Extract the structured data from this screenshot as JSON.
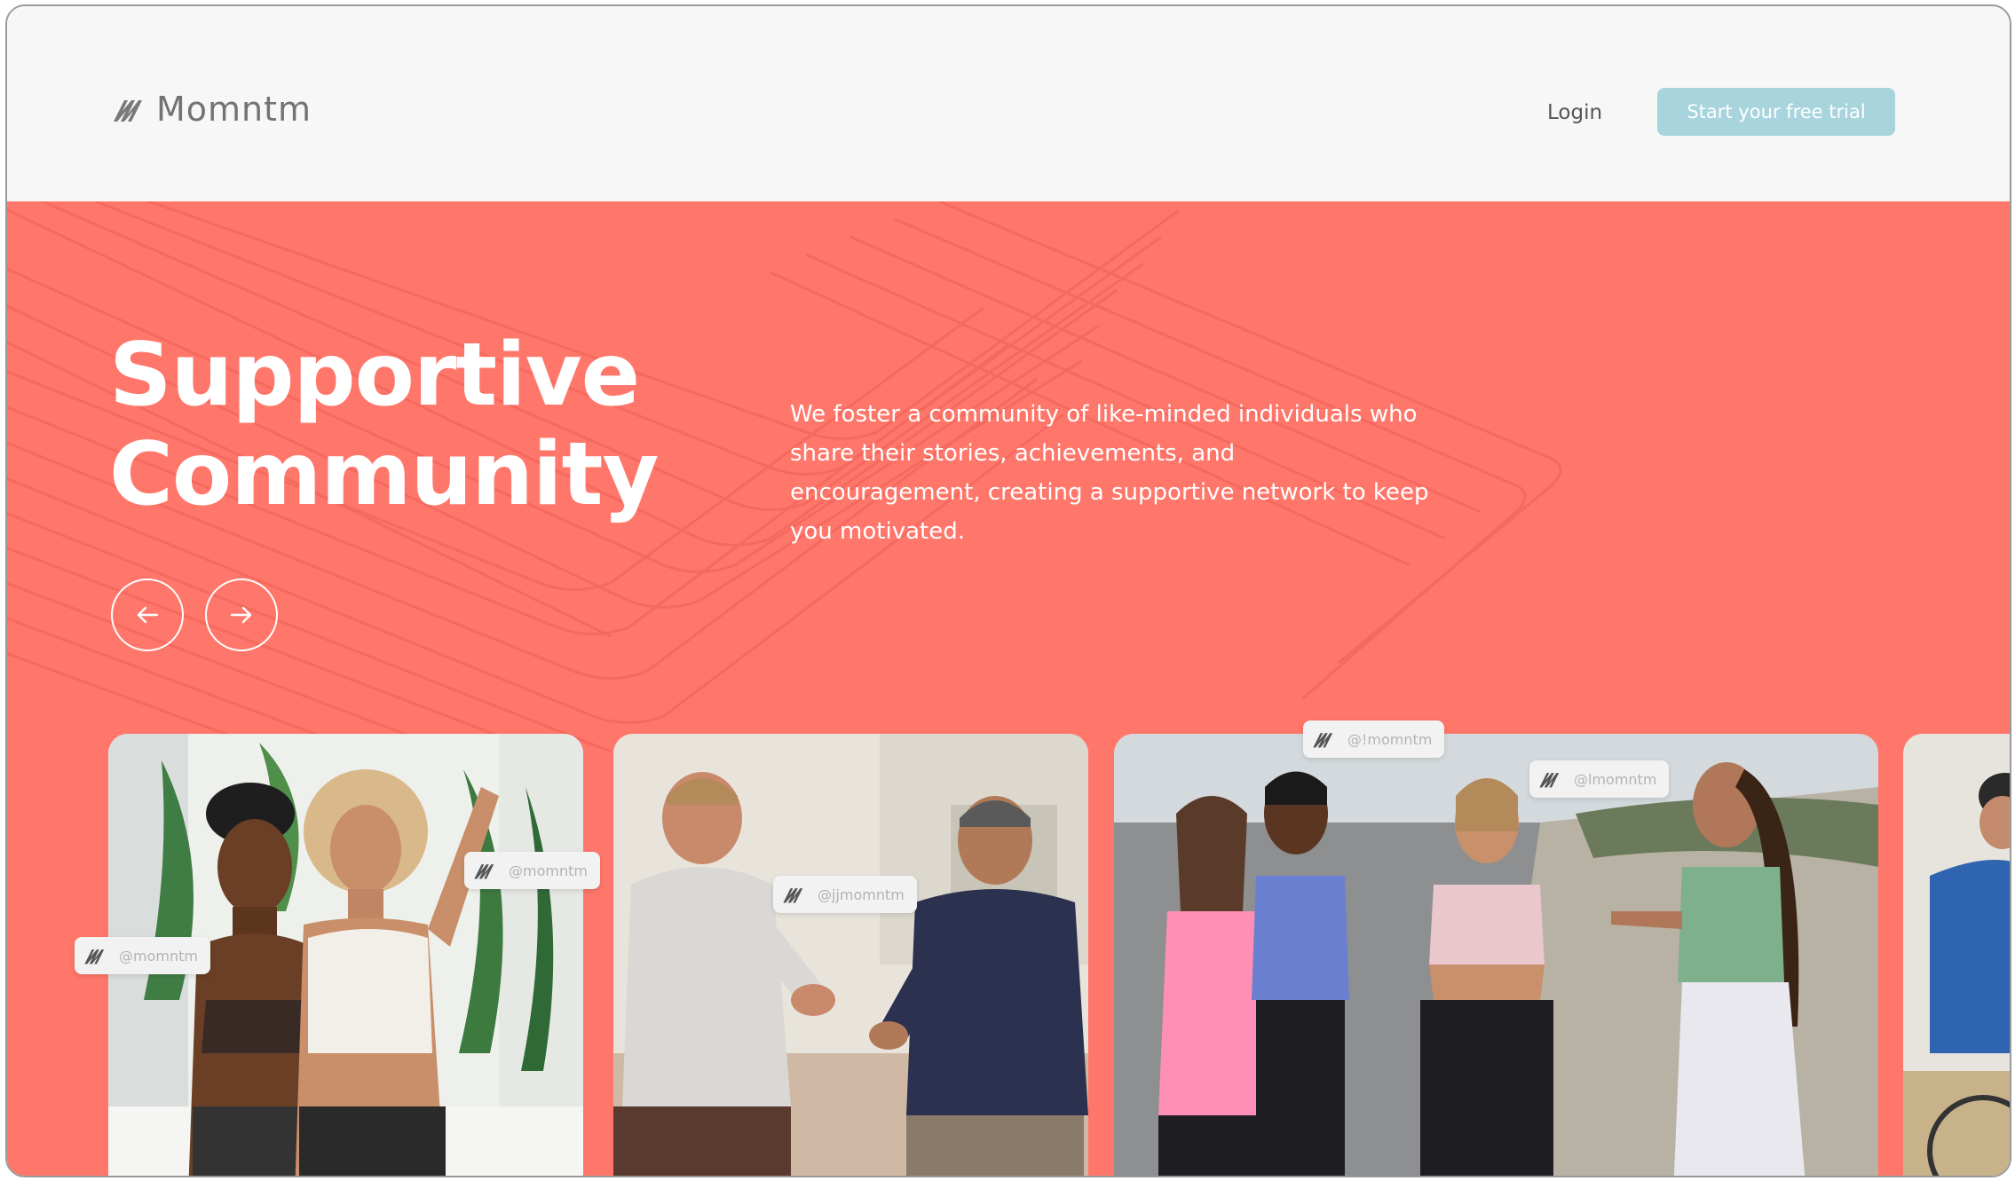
{
  "header": {
    "logo_text": "Momntm",
    "login_label": "Login",
    "cta_label": "Start your free trial"
  },
  "hero": {
    "title_line1": "Supportive",
    "title_line2": "Community",
    "description": "We foster a community of like-minded individuals who share their stories, achievements, and encouragement, creating a supportive network to keep you motivated.",
    "prev_icon": "arrow-left-icon",
    "next_icon": "arrow-right-icon"
  },
  "cards": [
    {
      "handles": [
        "@momntm",
        "@momntm"
      ]
    },
    {
      "handles": [
        "@jjmomntm"
      ]
    },
    {
      "handles": [
        "@!momntm",
        "@lmomntm"
      ]
    }
  ],
  "colors": {
    "accent": "#ff766a",
    "cta": "#a8d4dd",
    "header_bg": "#f7f7f7"
  }
}
